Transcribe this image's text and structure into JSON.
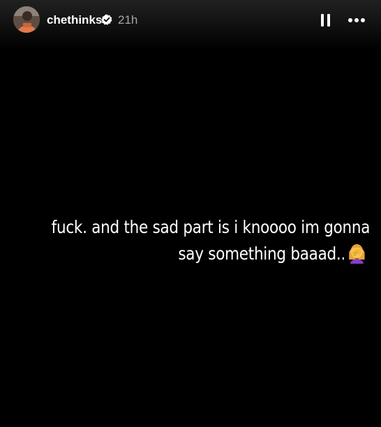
{
  "header": {
    "username": "chethinks",
    "time": "21h",
    "avatar_icon": "profile-photo",
    "verified_icon": "verified-badge-icon",
    "pause_icon": "pause-icon",
    "more_icon": "more-options-icon"
  },
  "story": {
    "text_line_1": "fuck. and the sad part is i knoooo im gonna",
    "text_line_2": "say something baaad..",
    "emoji_icon": "woman-facepalming-emoji"
  },
  "colors": {
    "background": "#000000",
    "text": "#ffffff",
    "secondary_text": "#a8a8a8"
  }
}
